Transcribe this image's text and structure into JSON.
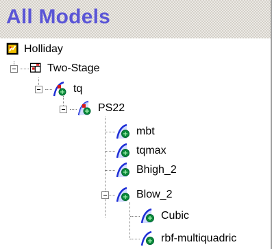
{
  "header": {
    "title": "All Models"
  },
  "tree": {
    "root": {
      "label": "Holliday",
      "icon": "project-icon"
    },
    "two_stage": {
      "label": "Two-Stage",
      "icon": "two-stage-model-icon"
    },
    "tq": {
      "label": "tq",
      "icon": "response-model-icon"
    },
    "ps22": {
      "label": "PS22",
      "icon": "response-model-icon"
    },
    "mbt": {
      "label": "mbt",
      "icon": "model-curve-icon"
    },
    "tqmax": {
      "label": "tqmax",
      "icon": "model-curve-icon"
    },
    "bhigh": {
      "label": "Bhigh_2",
      "icon": "model-curve-icon"
    },
    "blow": {
      "label": "Blow_2",
      "icon": "model-curve-icon"
    },
    "cubic": {
      "label": "Cubic",
      "icon": "model-curve-icon"
    },
    "rbf": {
      "label": "rbf-multiquadric",
      "icon": "model-curve-icon"
    }
  },
  "colors": {
    "title": "#5a55d6",
    "curve": "#1f2fd6",
    "marker": "#d81818",
    "globe": "#0b8a3a"
  }
}
